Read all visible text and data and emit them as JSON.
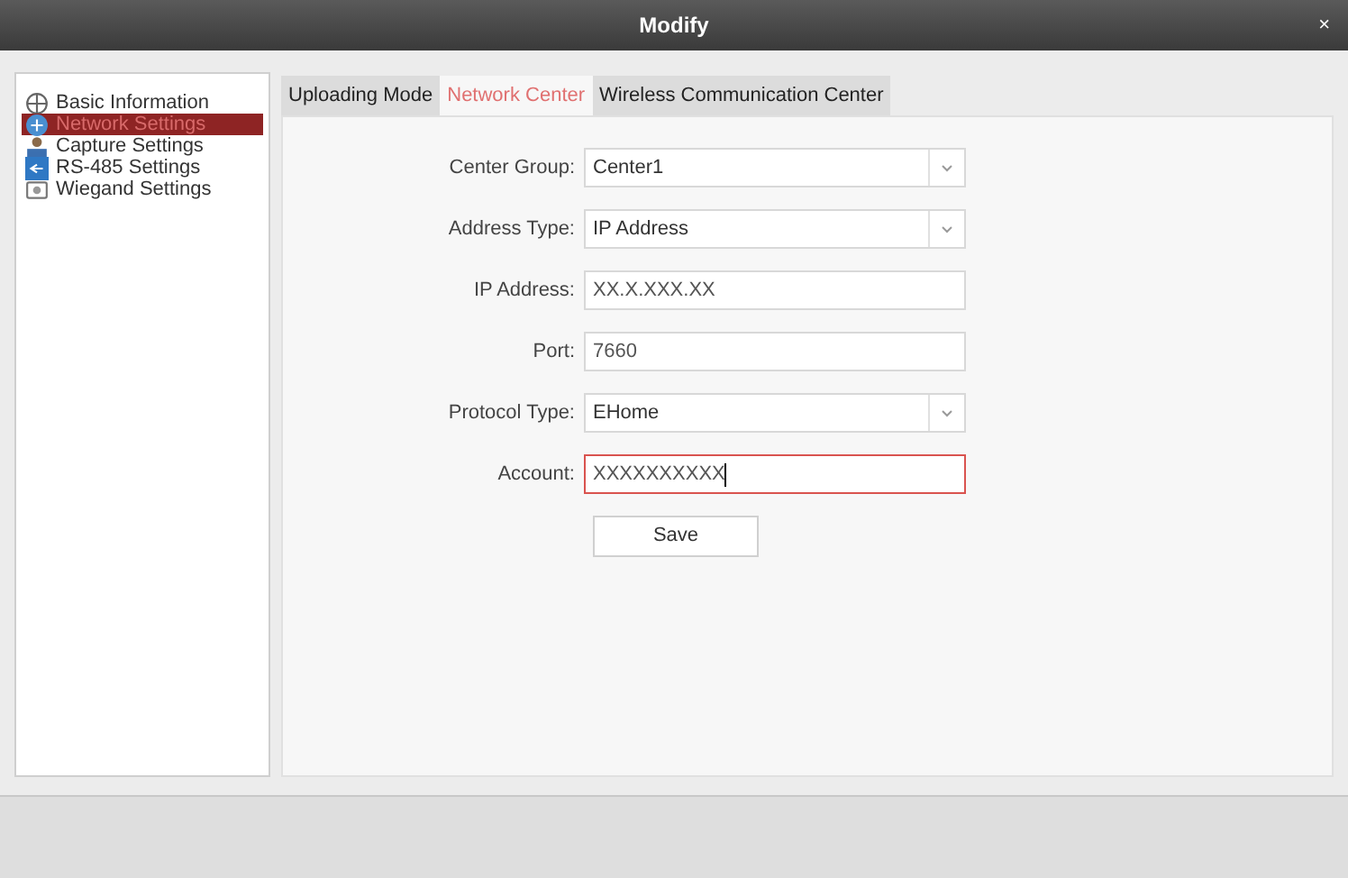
{
  "window": {
    "title": "Modify",
    "close": "×"
  },
  "sidebar": {
    "items": [
      {
        "label": "Basic Information",
        "selected": false
      },
      {
        "label": "Network Settings",
        "selected": true
      },
      {
        "label": "Capture Settings",
        "selected": false
      },
      {
        "label": "RS-485 Settings",
        "selected": false
      },
      {
        "label": "Wiegand Settings",
        "selected": false
      }
    ]
  },
  "tabs": [
    {
      "label": "Uploading Mode",
      "selected": false
    },
    {
      "label": "Network Center",
      "selected": true
    },
    {
      "label": "Wireless Communication Center",
      "selected": false
    }
  ],
  "form": {
    "fields": [
      {
        "kind": "select",
        "label": "Center Group:",
        "value": "Center1",
        "focused": false
      },
      {
        "kind": "select",
        "label": "Address Type:",
        "value": "IP Address",
        "focused": false
      },
      {
        "kind": "text",
        "label": "IP Address:",
        "value": "XX.X.XXX.XX",
        "focused": false
      },
      {
        "kind": "text",
        "label": "Port:",
        "value": "7660",
        "focused": false
      },
      {
        "kind": "select",
        "label": "Protocol Type:",
        "value": "EHome",
        "focused": false
      },
      {
        "kind": "text",
        "label": "Account:",
        "value": "XXXXXXXXXX",
        "focused": true
      }
    ],
    "button": "Save"
  }
}
